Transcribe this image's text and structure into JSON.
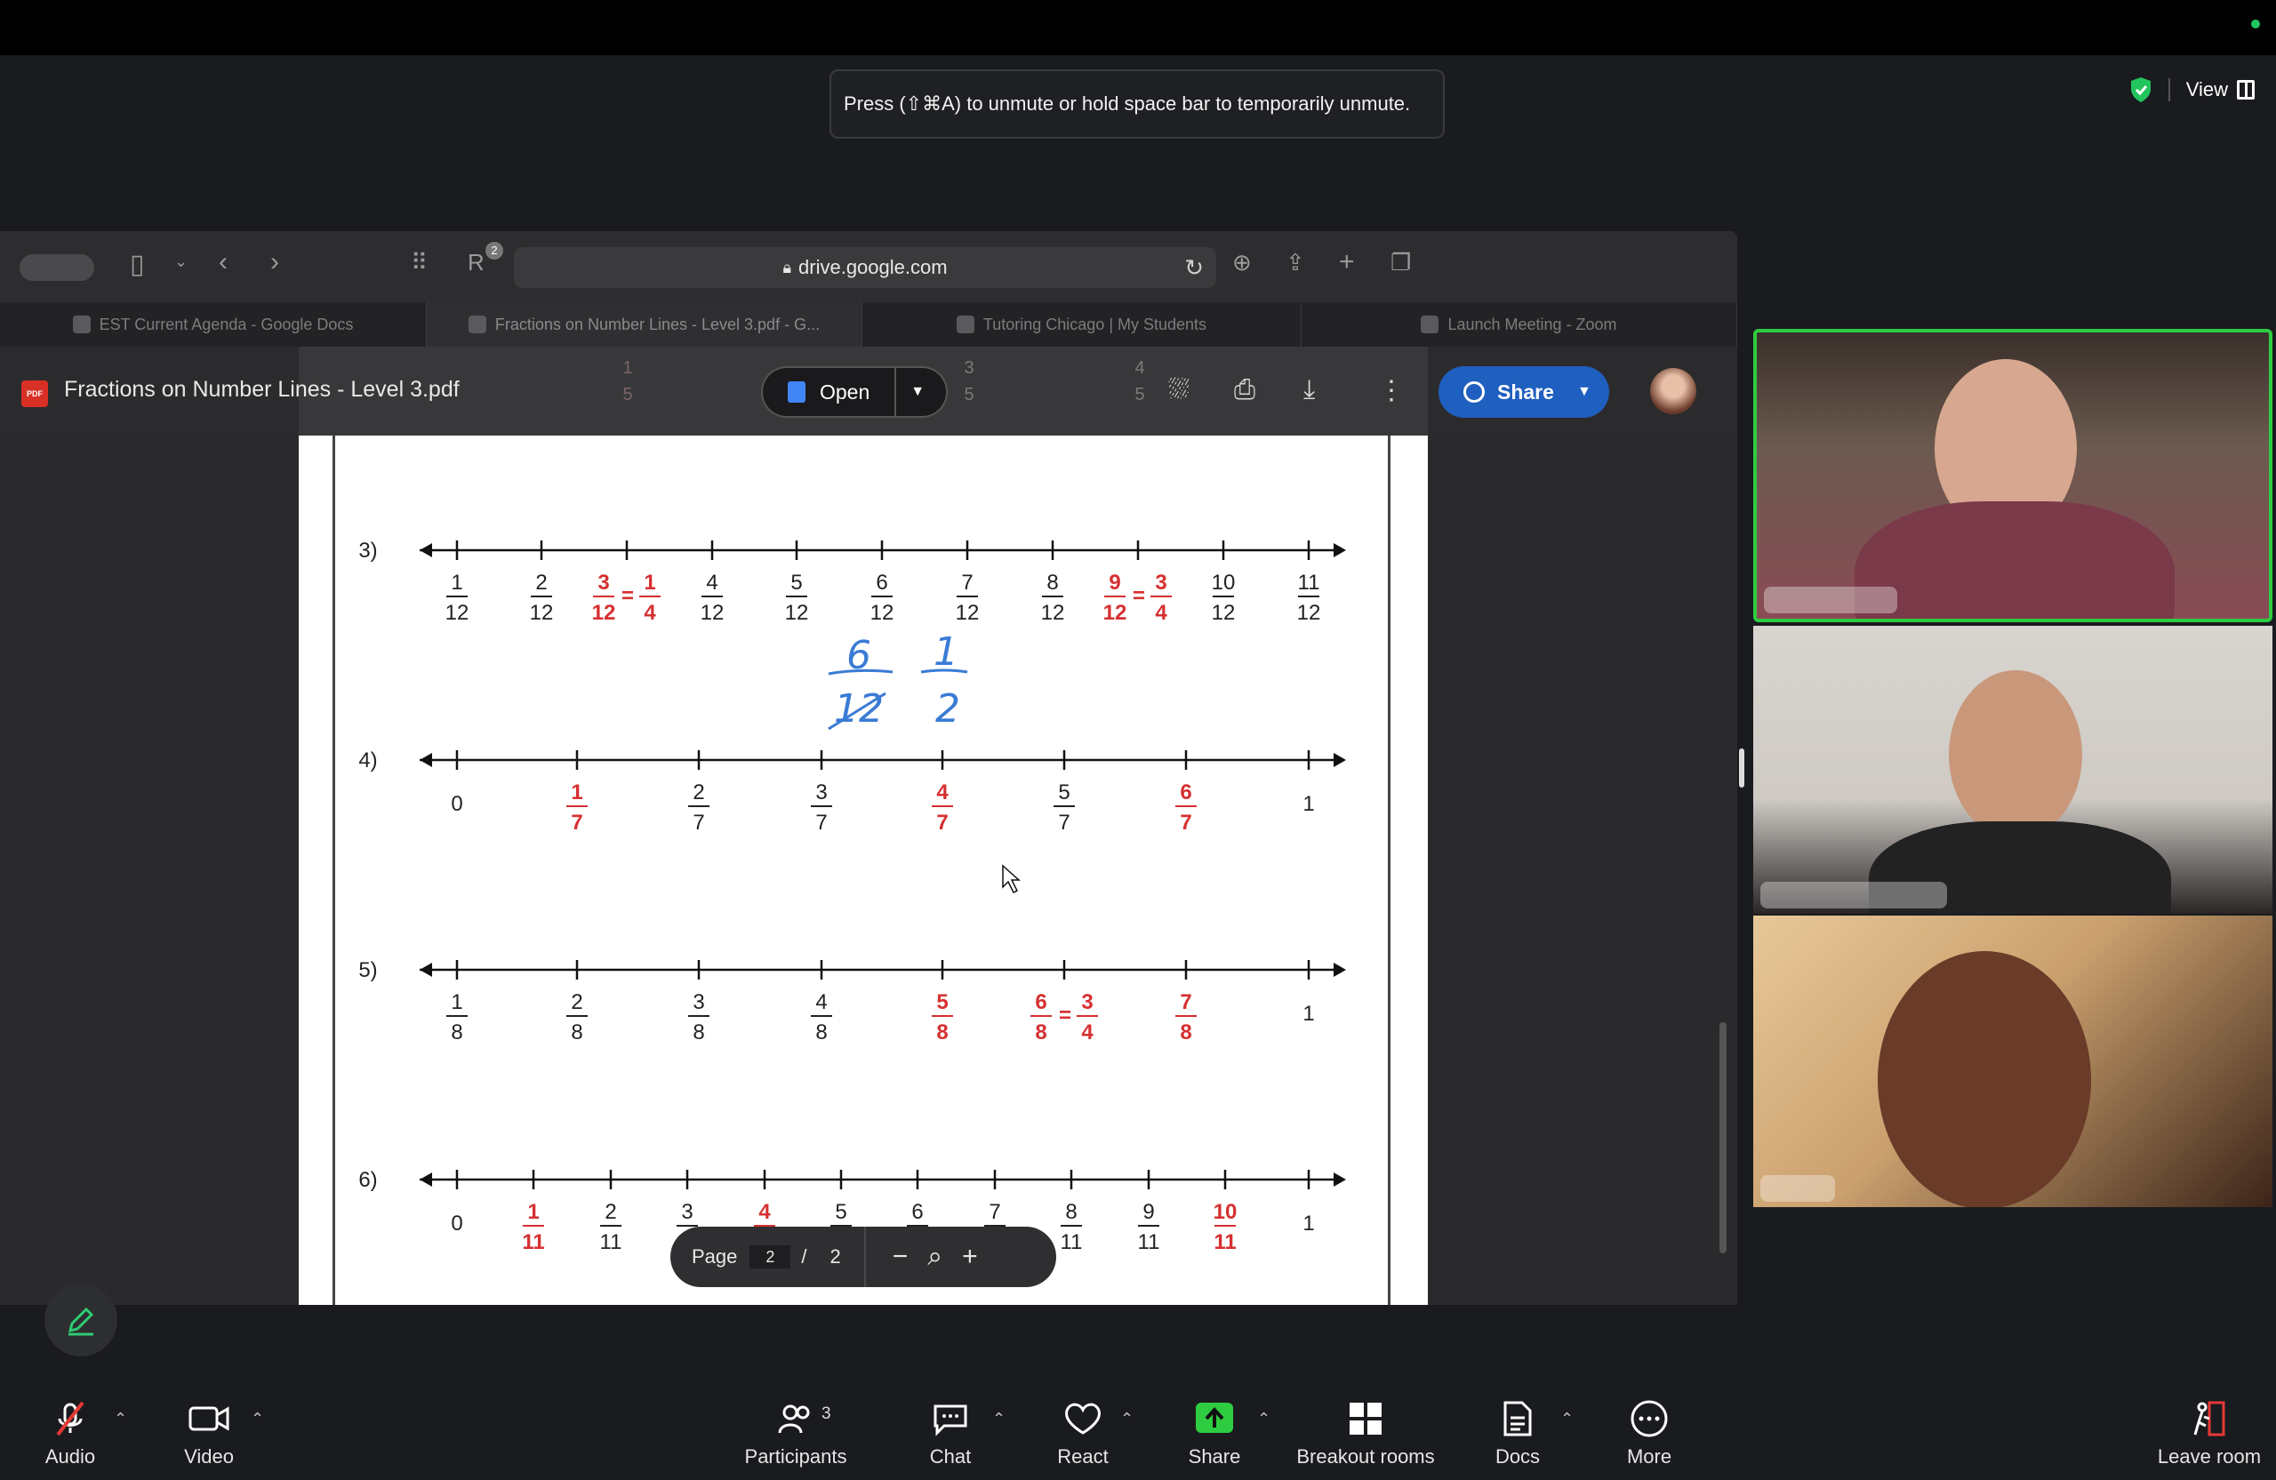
{
  "toast": {
    "text": "Press  (⇧⌘A) to unmute or hold space bar to temporarily unmute."
  },
  "view_control": {
    "label": "View",
    "icon": "view-grid-icon"
  },
  "browser": {
    "url": "drive.google.com",
    "badge_count": "2",
    "tabs": [
      {
        "label": "EST Current Agenda - Google Docs"
      },
      {
        "label": "Fractions on Number Lines - Level 3.pdf - G..."
      },
      {
        "label": "Tutoring Chicago | My Students"
      },
      {
        "label": "Launch Meeting - Zoom"
      }
    ]
  },
  "drive": {
    "pdf_badge": "PDF",
    "doc_title": "Fractions on Number Lines - Level 3.pdf",
    "open_label": "Open",
    "share_label": "Share",
    "ghost_header": [
      "1",
      "5",
      "3",
      "5",
      "4",
      "5"
    ]
  },
  "pdf": {
    "problems": [
      {
        "label": "3)",
        "ticks": [
          {
            "n": "1",
            "d": "12",
            "red": false
          },
          {
            "n": "2",
            "d": "12",
            "red": false
          },
          {
            "n": "3",
            "d": "12",
            "red": true,
            "eq_n": "1",
            "eq_d": "4"
          },
          {
            "n": "4",
            "d": "12",
            "red": false
          },
          {
            "n": "5",
            "d": "12",
            "red": false
          },
          {
            "n": "6",
            "d": "12",
            "red": false
          },
          {
            "n": "7",
            "d": "12",
            "red": false
          },
          {
            "n": "8",
            "d": "12",
            "red": false
          },
          {
            "n": "9",
            "d": "12",
            "red": true,
            "eq_n": "3",
            "eq_d": "4"
          },
          {
            "n": "10",
            "d": "12",
            "red": false
          },
          {
            "n": "11",
            "d": "12",
            "red": false
          }
        ]
      },
      {
        "label": "4)",
        "ticks": [
          {
            "w": "0"
          },
          {
            "n": "1",
            "d": "7",
            "red": true
          },
          {
            "n": "2",
            "d": "7",
            "red": false
          },
          {
            "n": "3",
            "d": "7",
            "red": false
          },
          {
            "n": "4",
            "d": "7",
            "red": true
          },
          {
            "n": "5",
            "d": "7",
            "red": false
          },
          {
            "n": "6",
            "d": "7",
            "red": true
          },
          {
            "w": "1"
          }
        ]
      },
      {
        "label": "5)",
        "ticks": [
          {
            "n": "1",
            "d": "8",
            "red": false
          },
          {
            "n": "2",
            "d": "8",
            "red": false
          },
          {
            "n": "3",
            "d": "8",
            "red": false
          },
          {
            "n": "4",
            "d": "8",
            "red": false
          },
          {
            "n": "5",
            "d": "8",
            "red": true
          },
          {
            "n": "6",
            "d": "8",
            "red": true,
            "eq_n": "3",
            "eq_d": "4"
          },
          {
            "n": "7",
            "d": "8",
            "red": true
          },
          {
            "w": "1"
          }
        ]
      },
      {
        "label": "6)",
        "ticks": [
          {
            "w": "0"
          },
          {
            "n": "1",
            "d": "11",
            "red": true
          },
          {
            "n": "2",
            "d": "11",
            "red": false
          },
          {
            "n": "3",
            "d": "11",
            "red": false
          },
          {
            "n": "4",
            "d": "11",
            "red": true
          },
          {
            "n": "5",
            "d": "11",
            "red": false
          },
          {
            "n": "6",
            "d": "11",
            "red": false
          },
          {
            "n": "7",
            "d": "11",
            "red": false
          },
          {
            "n": "8",
            "d": "11",
            "red": false
          },
          {
            "n": "9",
            "d": "11",
            "red": false
          },
          {
            "n": "10",
            "d": "11",
            "red": true
          },
          {
            "w": "1"
          }
        ]
      }
    ],
    "annotation": {
      "a": "6",
      "b": "12",
      "c": "1",
      "d": "2"
    },
    "page": {
      "label": "Page",
      "current": "2",
      "separator": "/",
      "total": "2"
    }
  },
  "bottom_bar": {
    "audio": "Audio",
    "video": "Video",
    "participants": "Participants",
    "participants_count": "3",
    "chat": "Chat",
    "react": "React",
    "share": "Share",
    "breakout": "Breakout rooms",
    "docs": "Docs",
    "more": "More",
    "leave": "Leave room"
  },
  "colors": {
    "accent_green": "#2ecc40",
    "share_blue": "#1f5fbf",
    "answer_red": "#d63031",
    "ink_blue": "#3a7bd5"
  }
}
